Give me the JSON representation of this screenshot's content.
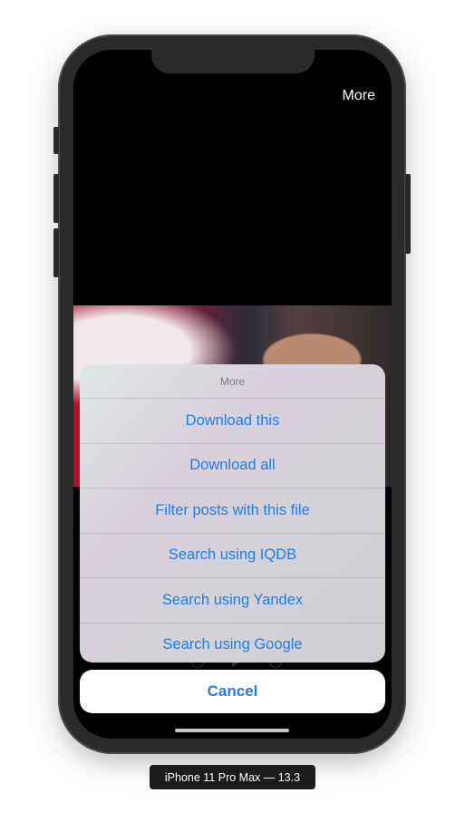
{
  "top_bar": {
    "more_label": "More"
  },
  "action_sheet": {
    "title": "More",
    "items": [
      {
        "label": "Download this"
      },
      {
        "label": "Download all"
      },
      {
        "label": "Filter posts with this file"
      },
      {
        "label": "Search using IQDB"
      },
      {
        "label": "Search using Yandex"
      },
      {
        "label": "Search using Google"
      }
    ],
    "cancel_label": "Cancel"
  },
  "simulator": {
    "device_label": "iPhone 11 Pro Max — 13.3"
  },
  "colors": {
    "accent": "#1f7ce8",
    "screen_bg": "#000000"
  }
}
